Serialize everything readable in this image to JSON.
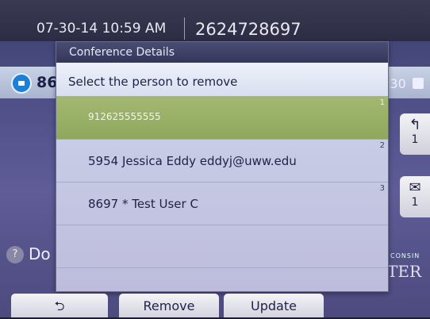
{
  "status_bar": {
    "datetime": "07-30-14 10:59 AM",
    "phone_number": "2624728697"
  },
  "background": {
    "line_label": "86",
    "line_right_value": ":30",
    "side_keys": [
      {
        "icon": "phone-back-icon",
        "symbol": "↰",
        "count": "1"
      },
      {
        "icon": "voicemail-icon",
        "symbol": "✉",
        "count": "1"
      }
    ],
    "bottom_left_label": "Do",
    "brand_small": "CONSIN",
    "brand_large": "TER"
  },
  "dialog": {
    "title": "Conference Details",
    "prompt": "Select the person to remove",
    "participants": [
      {
        "label": "912625555555",
        "index": "1",
        "selected": true
      },
      {
        "label": "5954 Jessica Eddy eddyj@uww.edu",
        "index": "2",
        "selected": false
      },
      {
        "label": "8697 * Test User C",
        "index": "3",
        "selected": false
      },
      {
        "label": "",
        "index": "",
        "selected": false
      },
      {
        "label": "",
        "index": "",
        "selected": false
      }
    ]
  },
  "softkeys": {
    "back_symbol": "⮌",
    "remove_label": "Remove",
    "update_label": "Update"
  },
  "colors": {
    "selected_row": "#9bb268",
    "dialog_title_bar": "#3c3f64",
    "line_icon": "#1d7fd6"
  }
}
